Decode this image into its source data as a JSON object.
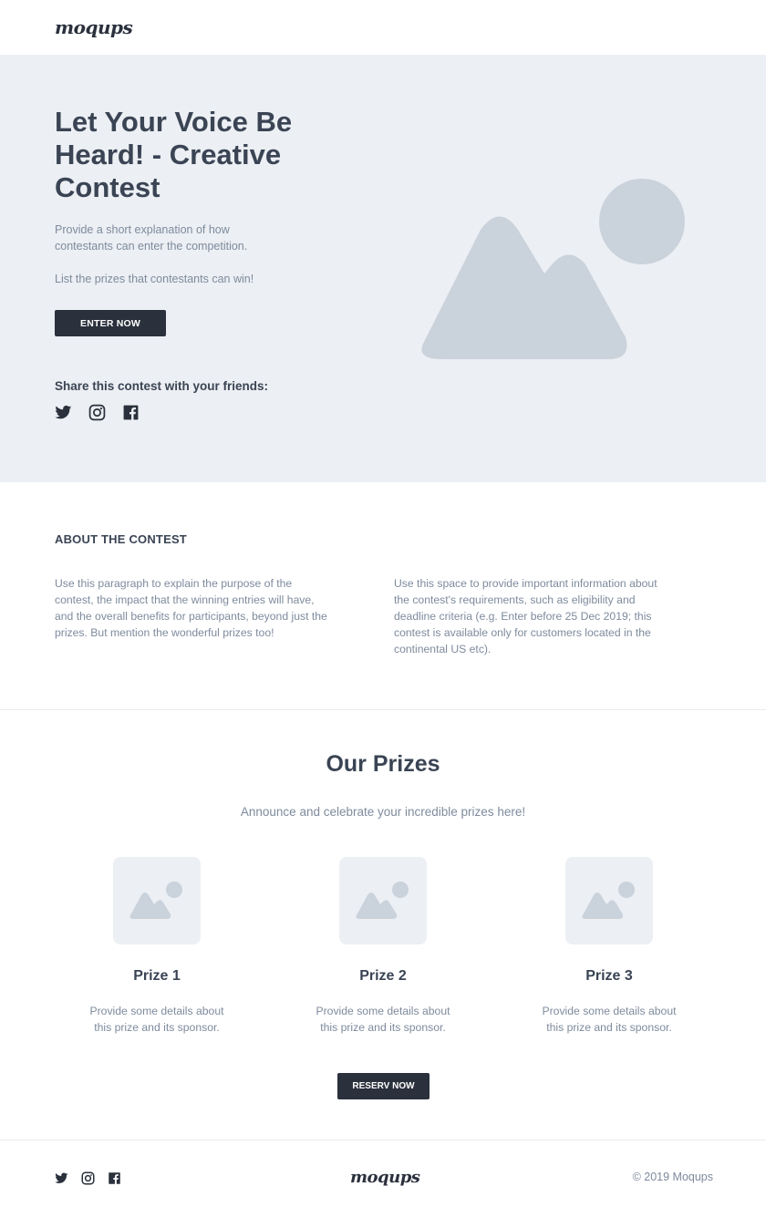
{
  "header": {
    "logo": "moqups"
  },
  "hero": {
    "title": "Let Your Voice Be Heard! - Creative Contest",
    "description": "Provide a short explanation of how contestants can enter the competition.",
    "prizes_text": "List the prizes that contestants can win!",
    "enter_button": "ENTER NOW",
    "share_label": "Share this contest with your friends:",
    "social_icons": [
      "twitter-icon",
      "instagram-icon",
      "facebook-icon"
    ],
    "image": "image-placeholder"
  },
  "about": {
    "title": "ABOUT THE CONTEST",
    "left": "Use this paragraph to explain the purpose of the contest, the impact that the winning entries will have, and the overall benefits for participants, beyond just the prizes. But mention the wonderful prizes too!",
    "right": "Use this space to provide important information about the contest's requirements, such as eligibility and deadline criteria (e.g. Enter before 25 Dec 2019; this contest is available only for customers located in the continental US etc)."
  },
  "prizes": {
    "title": "Our Prizes",
    "subtitle": "Announce and celebrate your incredible prizes here!",
    "items": [
      {
        "name": "Prize 1",
        "desc": "Provide some details about this prize and its sponsor."
      },
      {
        "name": "Prize 2",
        "desc": "Provide some details about this prize and its sponsor."
      },
      {
        "name": "Prize 3",
        "desc": "Provide some details about this prize and its sponsor."
      }
    ],
    "button": "RESERV NOW"
  },
  "footer": {
    "logo": "moqups",
    "copyright": "© 2019  Moqups",
    "social_icons": [
      "twitter-icon",
      "instagram-icon",
      "facebook-icon"
    ]
  },
  "colors": {
    "dark": "#2a303c",
    "hero_bg": "#eceff3",
    "placeholder": "#cad2dc",
    "text_muted": "#7e8b9d",
    "heading": "#3a4454"
  }
}
